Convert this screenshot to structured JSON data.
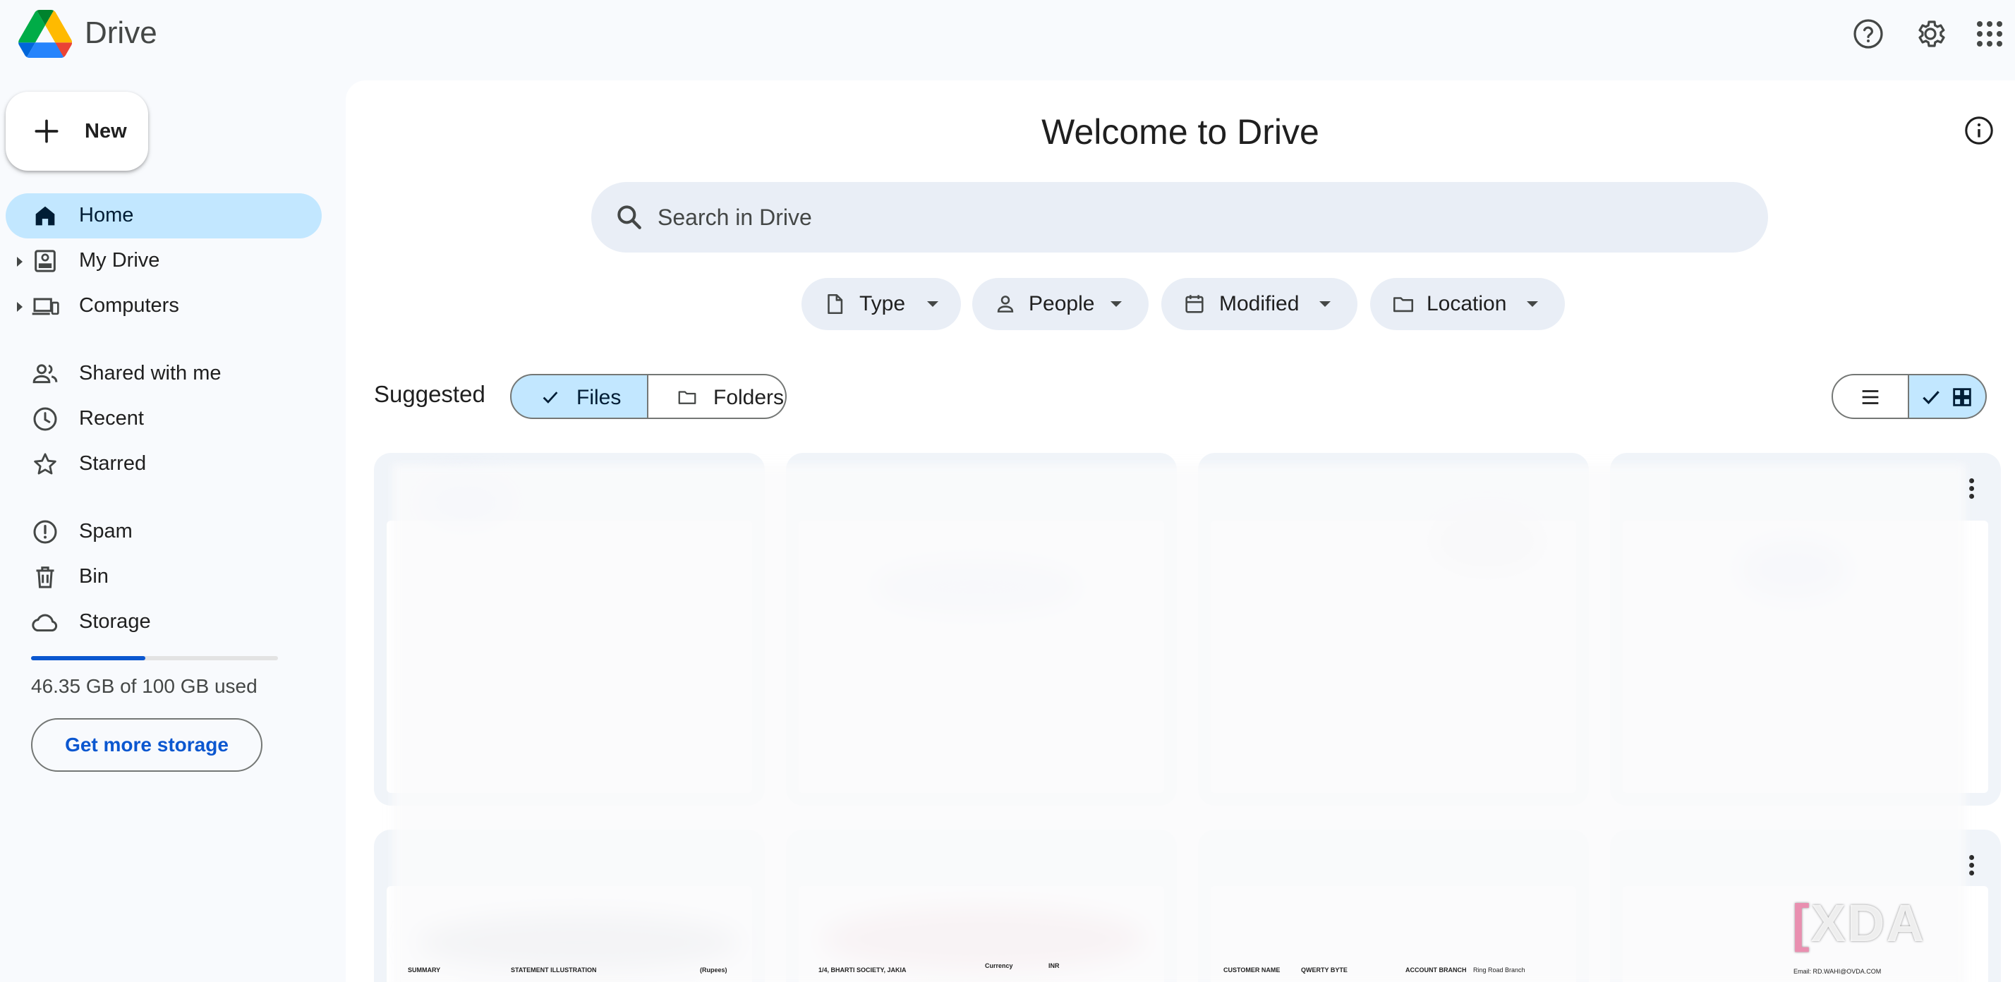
{
  "app": {
    "title": "Drive"
  },
  "header": {
    "help_icon": "help-icon",
    "settings_icon": "settings-icon",
    "apps_icon": "apps-grid-icon"
  },
  "sidebar": {
    "new_button": "New",
    "items": [
      {
        "label": "Home",
        "icon": "home-icon",
        "active": true
      },
      {
        "label": "My Drive",
        "icon": "my-drive-icon",
        "expandable": true
      },
      {
        "label": "Computers",
        "icon": "computers-icon",
        "expandable": true
      },
      {
        "label": "Shared with me",
        "icon": "shared-icon"
      },
      {
        "label": "Recent",
        "icon": "clock-icon"
      },
      {
        "label": "Starred",
        "icon": "star-icon"
      },
      {
        "label": "Spam",
        "icon": "spam-icon"
      },
      {
        "label": "Bin",
        "icon": "bin-icon"
      },
      {
        "label": "Storage",
        "icon": "cloud-icon"
      }
    ],
    "storage": {
      "used_text": "46.35 GB of 100 GB used",
      "used_fraction": 0.4635,
      "button": "Get more storage"
    }
  },
  "main": {
    "title": "Welcome to Drive",
    "search": {
      "placeholder": "Search in Drive",
      "value": ""
    },
    "filters": [
      "Type",
      "People",
      "Modified",
      "Location"
    ],
    "suggested": {
      "label": "Suggested",
      "toggle": {
        "files": "Files",
        "folders": "Folders",
        "selected": "Files"
      }
    },
    "view": {
      "selected": "grid"
    },
    "document_snippets": [
      "SUMMARY",
      "STATEMENT ILLUSTRATION",
      "(Rupees)",
      "1/4, BHARTI SOCIETY, JAKIA",
      "Currency",
      "INR",
      "CUSTOMER NAME",
      "QWERTY BYTE",
      "ACCOUNT BRANCH",
      "Ring Road Branch",
      "Email: RD.WAHI@OVDA.COM"
    ]
  },
  "watermark": "XDA",
  "colors": {
    "accent": "#0b57d0",
    "active_bg": "#c2e7ff",
    "chip_bg": "#e9eef6",
    "page_bg": "#f8fafd"
  }
}
